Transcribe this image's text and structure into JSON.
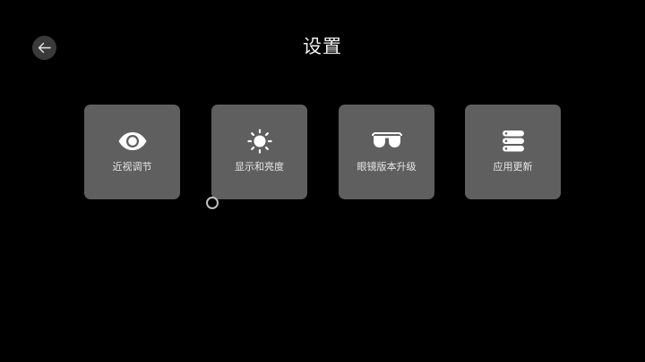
{
  "header": {
    "title": "设置",
    "back_icon": "arrow-left-icon"
  },
  "tiles": [
    {
      "label": "近视调节",
      "icon": "eye-icon"
    },
    {
      "label": "显示和亮度",
      "icon": "sun-icon"
    },
    {
      "label": "眼镜版本升级",
      "icon": "glasses-icon"
    },
    {
      "label": "应用更新",
      "icon": "stack-icon"
    }
  ],
  "colors": {
    "background": "#000000",
    "tile_background": "#5f5f5f",
    "text": "#e6e6e6",
    "back_button_background": "#3a3a3a"
  }
}
